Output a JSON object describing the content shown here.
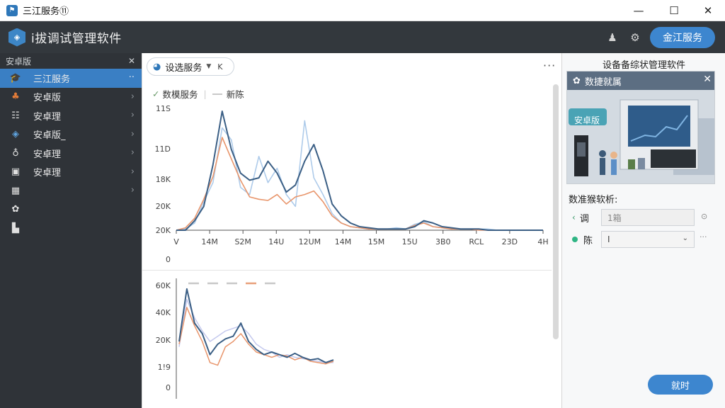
{
  "window": {
    "title": "三江服务⑪",
    "minimize": "—",
    "maximize": "☐",
    "close": "✕"
  },
  "app": {
    "title": "i拔调试管理软件",
    "primary_button": "金江服务"
  },
  "sidebar": {
    "header": "安卓版",
    "close": "✕",
    "items": [
      {
        "label": "三江服务",
        "icon": "graduation-cap-icon",
        "active": true,
        "trail": "··"
      },
      {
        "label": "安卓版",
        "icon": "people-icon"
      },
      {
        "label": "安卓理",
        "icon": "bars-icon"
      },
      {
        "label": "安卓版_",
        "icon": "eye-icon"
      },
      {
        "label": "安卓理",
        "icon": "lightbulb-icon"
      },
      {
        "label": "安卓理",
        "icon": "lock-icon"
      },
      {
        "label": "",
        "icon": "grid-icon"
      },
      {
        "label": "",
        "icon": "gear-small-icon"
      },
      {
        "label": "",
        "icon": "bag-icon"
      }
    ]
  },
  "main": {
    "tab": {
      "label": "设选服务",
      "close": "K"
    },
    "legend": [
      {
        "label": "数模服务",
        "color": "#4a7fb8"
      },
      {
        "label": "新陈",
        "color": "#c9c9c9"
      }
    ],
    "more": "···"
  },
  "chart_data": [
    {
      "type": "line",
      "y_tick_labels": [
        "11S",
        "11D",
        "18K",
        "20K",
        "20K",
        "0"
      ],
      "x_tick_labels": [
        "V",
        "14M",
        "S2M",
        "14U",
        "12UM",
        "14M",
        "15M",
        "15U",
        "3B0",
        "RCL",
        "23D",
        "4H"
      ],
      "series": [
        {
          "color": "#3b5f85",
          "values": [
            0,
            0,
            8,
            20,
            55,
            100,
            68,
            48,
            42,
            44,
            58,
            48,
            32,
            38,
            58,
            72,
            50,
            22,
            12,
            6,
            3,
            2,
            1,
            1,
            1,
            1,
            3,
            8,
            6,
            3,
            2,
            1,
            1,
            1,
            0,
            0,
            0,
            0,
            0,
            0,
            0
          ]
        },
        {
          "color": "#e8956b",
          "values": [
            0,
            2,
            10,
            26,
            45,
            78,
            60,
            42,
            28,
            26,
            25,
            30,
            22,
            28,
            30,
            33,
            24,
            12,
            6,
            3,
            2,
            1,
            1,
            1,
            1,
            1,
            4,
            6,
            3,
            2,
            1,
            1,
            1,
            0,
            0,
            0,
            0,
            0,
            0,
            0,
            0
          ]
        },
        {
          "color": "#aecbea",
          "values": [
            0,
            1,
            6,
            24,
            40,
            86,
            76,
            36,
            30,
            62,
            40,
            52,
            30,
            20,
            92,
            44,
            30,
            14,
            6,
            3,
            2,
            1,
            1,
            1,
            2,
            1,
            5,
            7,
            3,
            2,
            1,
            1,
            1,
            1,
            1,
            0,
            0,
            0,
            0,
            0,
            0
          ]
        }
      ]
    },
    {
      "type": "line",
      "y_tick_labels": [
        "60K",
        "40K",
        "20K",
        "1!9",
        "0"
      ],
      "legend_colors": [
        "#c8c8c8",
        "#c8c8c8",
        "#c8c8c8",
        "#e8a07b",
        "#c8c8c8"
      ],
      "series": [
        {
          "color": "#3b5f85",
          "values": [
            22,
            62,
            36,
            28,
            12,
            20,
            24,
            26,
            36,
            22,
            16,
            12,
            14,
            12,
            10,
            13,
            10,
            8,
            9,
            6,
            8
          ]
        },
        {
          "color": "#e8956b",
          "values": [
            20,
            48,
            34,
            22,
            6,
            4,
            18,
            22,
            28,
            20,
            14,
            12,
            10,
            12,
            11,
            8,
            10,
            7,
            6,
            5,
            7
          ]
        },
        {
          "color": "#c4c9ee",
          "values": [
            18,
            54,
            40,
            30,
            22,
            26,
            30,
            32,
            34,
            28,
            20,
            16,
            14,
            10,
            12,
            10,
            9,
            8,
            7,
            6,
            6
          ]
        }
      ]
    }
  ],
  "right_panel": {
    "title": "设备备综状管理软件",
    "card": {
      "title": "数捷就属",
      "close": "✕",
      "bubble": "安卓版"
    },
    "section": "数准猴软析:",
    "fields": [
      {
        "label": "调",
        "value": "1箱",
        "icon": "arrow-icon",
        "trail": "⊙"
      },
      {
        "label": "陈",
        "value": "I",
        "icon": "dot-icon",
        "trail": "···"
      }
    ],
    "apply": "就时"
  },
  "colors": {
    "accent": "#3d86cf",
    "sidebar": "#2f3338",
    "appbar": "#33383d"
  }
}
